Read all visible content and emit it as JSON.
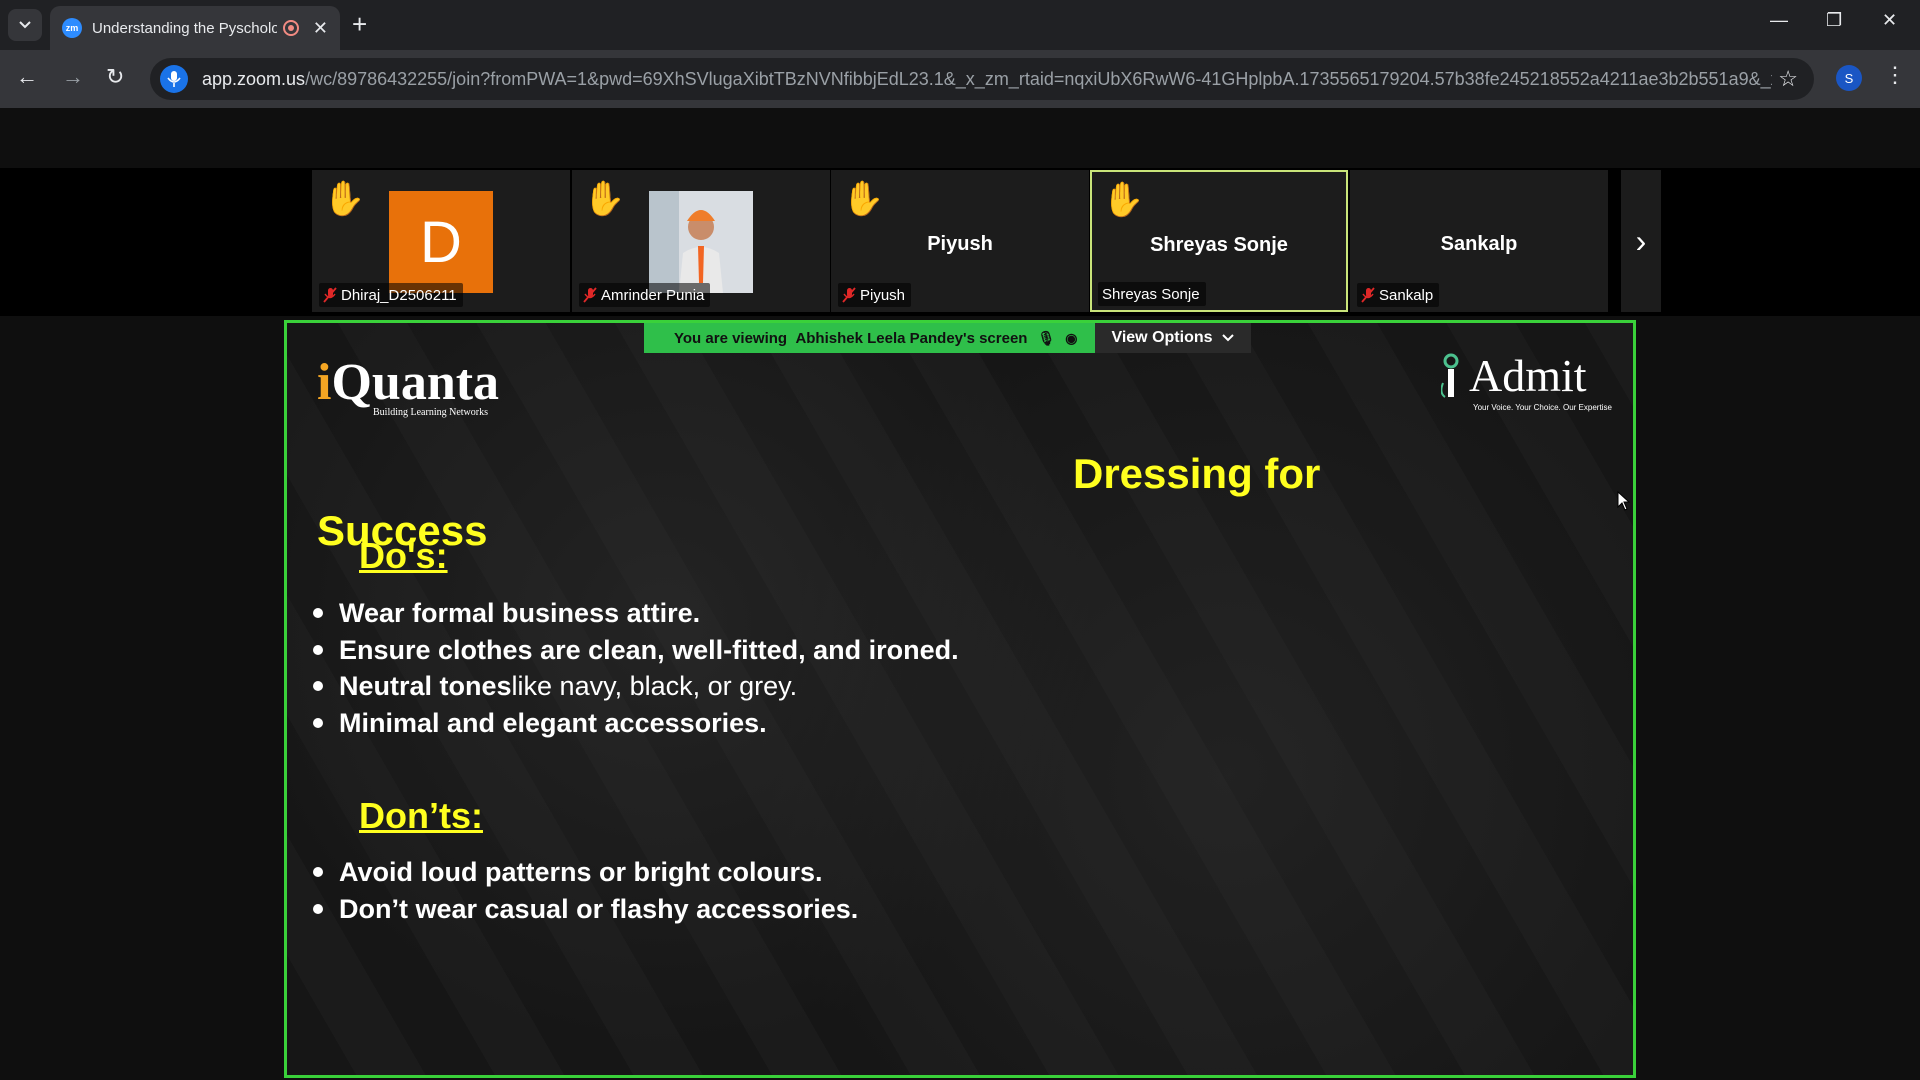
{
  "browser": {
    "tab_title": "Understanding the Pyscholo",
    "tab_favicon_text": "zm",
    "url_main": "app.zoom.us",
    "url_rest": "/wc/89786432255/join?fromPWA=1&pwd=69XhSVlugaXibtTBzNVNfibbjEdL23.1&_x_zm_rtaid=nqxiUbX6RwW6-41GHplpbA.1735565179204.57b38fe245218552a4211ae3b2b551a9&_x_zm_...",
    "profile_initial": "S"
  },
  "gallery": {
    "participants": [
      {
        "name": "Dhiraj_D2506211",
        "avatar_letter": "D",
        "hand_raised": true,
        "muted": true
      },
      {
        "name": "Amrinder Punia",
        "hand_raised": true,
        "muted": true
      },
      {
        "name": "Piyush",
        "center_name": "Piyush",
        "hand_raised": true,
        "muted": true
      },
      {
        "name": "Shreyas Sonje",
        "center_name": "Shreyas Sonje",
        "hand_raised": true,
        "muted": false,
        "active_speaker": true
      },
      {
        "name": "Sankalp",
        "center_name": "Sankalp",
        "hand_raised": false,
        "muted": true
      }
    ]
  },
  "share": {
    "viewing_prefix": "You are viewing",
    "viewing_name": "Abhishek Leela Pandey's screen",
    "view_options_label": "View Options",
    "accent_color": "#3ad13a"
  },
  "slide": {
    "logo_left": {
      "prefix": "i",
      "main": "Quanta",
      "tagline": "Building Learning Networks"
    },
    "logo_right": {
      "main": "Admit",
      "tagline": "Your Voice. Your Choice. Our Expertise"
    },
    "title_line1": "Dressing for",
    "title_line2": "Success",
    "dos_heading": "Do's:",
    "dos": [
      {
        "bold": "Wear formal business attire.",
        "normal": ""
      },
      {
        "bold": "Ensure clothes are clean, well-fitted, and ironed.",
        "normal": ""
      },
      {
        "bold": "Neutral tones",
        "normal": " like navy, black, or grey."
      },
      {
        "bold": "Minimal and elegant accessories.",
        "normal": ""
      }
    ],
    "donts_heading": "Don’ts:",
    "donts": [
      {
        "bold": "Avoid loud patterns or bright colours.",
        "normal": ""
      },
      {
        "bold": "Don’t wear casual or flashy accessories.",
        "normal": ""
      }
    ],
    "highlight_color": "#ffff1f"
  }
}
